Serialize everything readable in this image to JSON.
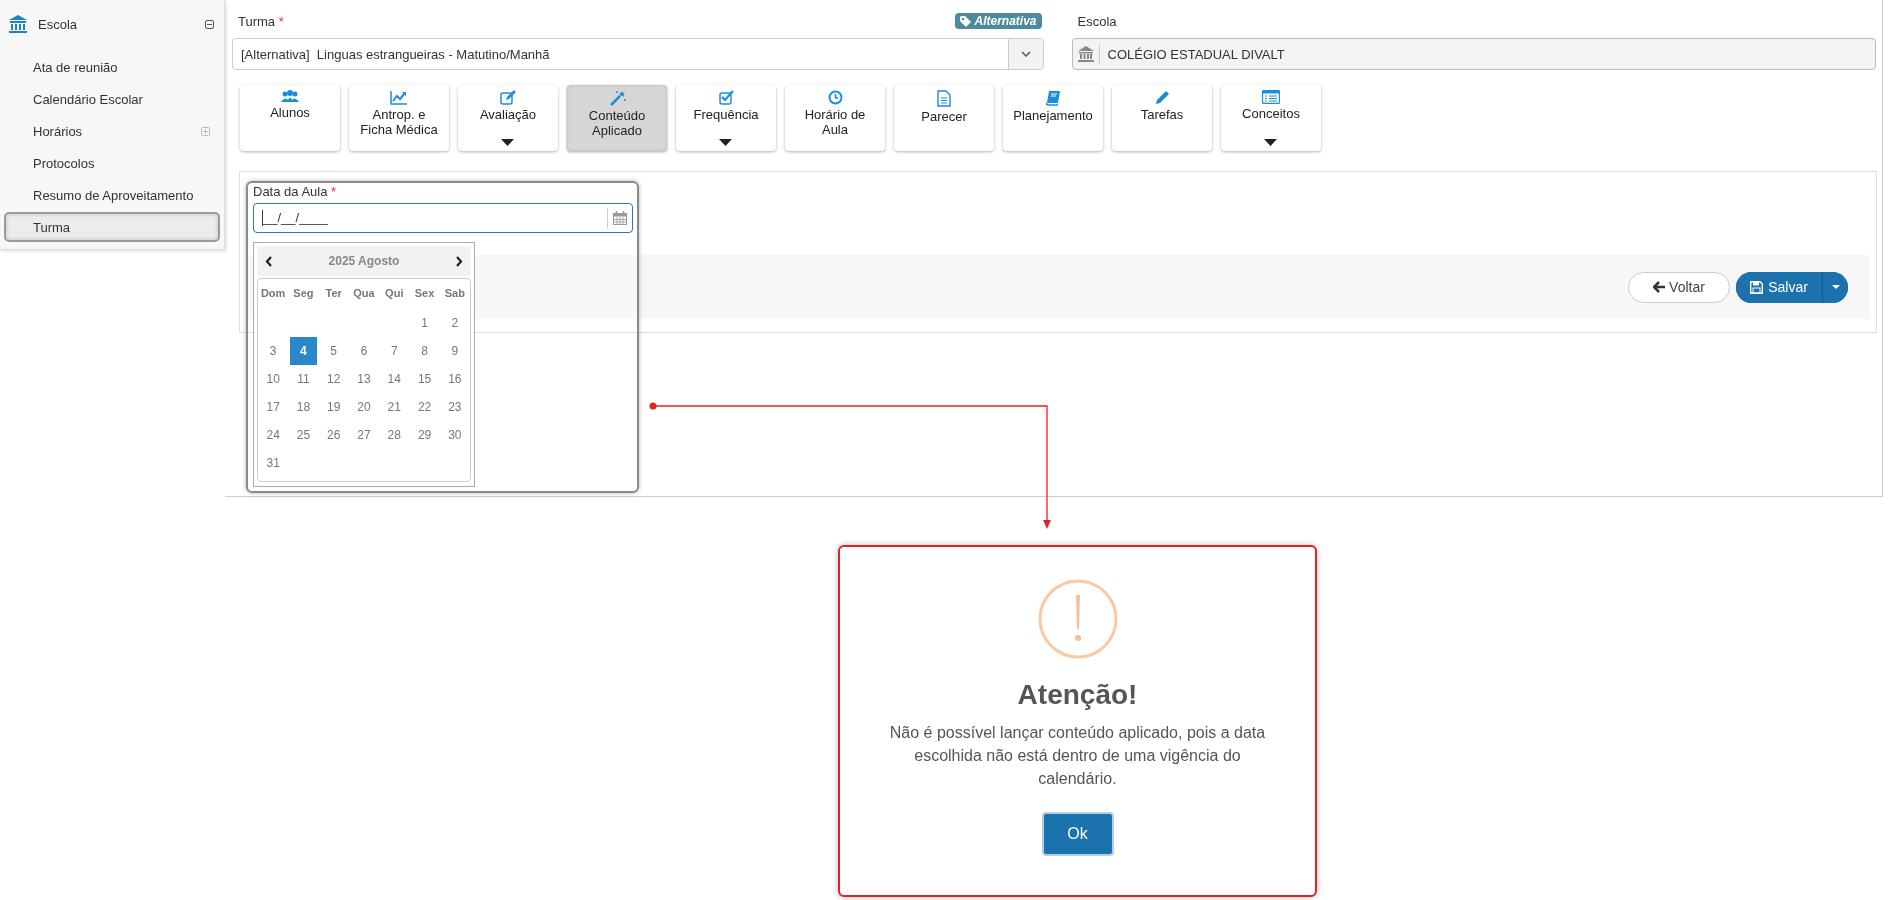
{
  "sidebar": {
    "section": {
      "label": "Escola",
      "expanded": true
    },
    "items": [
      {
        "label": "Ata de reunião",
        "kind": "link",
        "selected": false
      },
      {
        "label": "Calendário Escolar",
        "kind": "link",
        "selected": false
      },
      {
        "label": "Horários",
        "kind": "group",
        "expanded": false,
        "selected": false
      },
      {
        "label": "Protocolos",
        "kind": "link",
        "selected": false
      },
      {
        "label": "Resumo de Aproveitamento",
        "kind": "link",
        "selected": false
      },
      {
        "label": "Turma",
        "kind": "link",
        "selected": true
      }
    ]
  },
  "turma": {
    "label": "Turma",
    "required_mark": "*",
    "badge": "Alternativa",
    "value": "[Alternativa]  Linguas estrangueiras - Matutino/Manhã"
  },
  "escola": {
    "label": "Escola",
    "value": "COLÉGIO ESTADUAL DIVALT"
  },
  "tabs": [
    {
      "label": "Alunos",
      "dropdown": false,
      "selected": false
    },
    {
      "label": "Antrop. e\nFicha Médica",
      "dropdown": false,
      "selected": false
    },
    {
      "label": "Avaliação",
      "dropdown": true,
      "selected": false
    },
    {
      "label": "Conteúdo\nAplicado",
      "dropdown": false,
      "selected": true
    },
    {
      "label": "Frequência",
      "dropdown": true,
      "selected": false
    },
    {
      "label": "Horário de\nAula",
      "dropdown": false,
      "selected": false
    },
    {
      "label": "Parecer",
      "dropdown": false,
      "selected": false
    },
    {
      "label": "Planejamento",
      "dropdown": false,
      "selected": false
    },
    {
      "label": "Tarefas",
      "dropdown": false,
      "selected": false
    },
    {
      "label": "Conceitos",
      "dropdown": true,
      "selected": false
    }
  ],
  "date_field": {
    "label": "Data da Aula",
    "required_mark": "*",
    "value": "__/__/____"
  },
  "calendar": {
    "title": "2025 Agosto",
    "weekdays": [
      "Dom",
      "Seg",
      "Ter",
      "Qua",
      "Qui",
      "Sex",
      "Sab"
    ],
    "weeks": [
      {
        "kind": "end",
        "days": [
          {
            "day": "1",
            "selected": false
          },
          {
            "day": "2",
            "selected": false
          }
        ]
      },
      {
        "kind": "full",
        "days": [
          {
            "day": "3",
            "selected": false
          },
          {
            "day": "4",
            "selected": true
          },
          {
            "day": "5",
            "selected": false
          },
          {
            "day": "6",
            "selected": false
          },
          {
            "day": "7",
            "selected": false
          },
          {
            "day": "8",
            "selected": false
          },
          {
            "day": "9",
            "selected": false
          }
        ]
      },
      {
        "kind": "full",
        "days": [
          {
            "day": "10",
            "selected": false
          },
          {
            "day": "11",
            "selected": false
          },
          {
            "day": "12",
            "selected": false
          },
          {
            "day": "13",
            "selected": false
          },
          {
            "day": "14",
            "selected": false
          },
          {
            "day": "15",
            "selected": false
          },
          {
            "day": "16",
            "selected": false
          }
        ]
      },
      {
        "kind": "full",
        "days": [
          {
            "day": "17",
            "selected": false
          },
          {
            "day": "18",
            "selected": false
          },
          {
            "day": "19",
            "selected": false
          },
          {
            "day": "20",
            "selected": false
          },
          {
            "day": "21",
            "selected": false
          },
          {
            "day": "22",
            "selected": false
          },
          {
            "day": "23",
            "selected": false
          }
        ]
      },
      {
        "kind": "full",
        "days": [
          {
            "day": "24",
            "selected": false
          },
          {
            "day": "25",
            "selected": false
          },
          {
            "day": "26",
            "selected": false
          },
          {
            "day": "27",
            "selected": false
          },
          {
            "day": "28",
            "selected": false
          },
          {
            "day": "29",
            "selected": false
          },
          {
            "day": "30",
            "selected": false
          }
        ]
      },
      {
        "kind": "start",
        "days": [
          {
            "day": "31",
            "selected": false
          }
        ]
      }
    ]
  },
  "actions": {
    "back": "Voltar",
    "save": "Salvar"
  },
  "dialog": {
    "title": "Atenção!",
    "message": "Não é possível lançar conteúdo aplicado, pois a data escolhida não está dentro de uma vigência do calendário.",
    "button": "Ok"
  }
}
